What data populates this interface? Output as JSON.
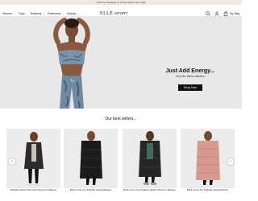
{
  "promo": {
    "text": "Get Free Shipping on All UK Orders Over £40"
  },
  "nav": {
    "items": [
      {
        "label": "Women",
        "has_dropdown": true
      },
      {
        "label": "Tops",
        "has_dropdown": true
      },
      {
        "label": "Bottoms",
        "has_dropdown": true
      },
      {
        "label": "Outerwear",
        "has_dropdown": true
      },
      {
        "label": "Activity",
        "has_dropdown": true
      }
    ]
  },
  "logo": {
    "brand": "ELLE",
    "sub": "SPORT"
  },
  "header_icons": {
    "search": "search-icon",
    "account": "user-icon",
    "bag": "bag-icon",
    "bag_label": "My Bag"
  },
  "hero": {
    "title": "Just Add Energy...",
    "subtitle": "Shop the latest collection",
    "cta": "Shop Now",
    "accent_color": "#8fb0c7"
  },
  "section": {
    "title": "Our best sellers..."
  },
  "products": [
    {
      "name": "Padded Jacket with Hood Women's Ellesse",
      "coat_color": "#2c2c2c"
    },
    {
      "name": "Bold Long Line Padded Jacket Ellesse",
      "coat_color": "#1b1b1b"
    },
    {
      "name": "Bold Long Line Padded Jacket Women's Ellesse",
      "coat_color": "#262626"
    },
    {
      "name": "Bold Long Line Padded Jacket Ellesse",
      "coat_color": "#d79a90"
    }
  ],
  "carousel": {
    "prev": "chevron-left-icon",
    "next": "chevron-right-icon"
  }
}
